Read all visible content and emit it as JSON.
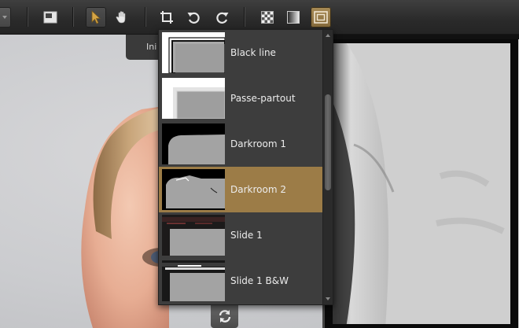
{
  "toolbar": {
    "tools": [
      {
        "icon": "layout-icon"
      },
      {
        "icon": "pointer-arrow-icon",
        "active": true
      },
      {
        "icon": "hand-pan-icon"
      },
      {
        "icon": "crop-icon"
      },
      {
        "icon": "rotate-left-icon"
      },
      {
        "icon": "rotate-right-icon"
      },
      {
        "icon": "checkerboard-icon"
      },
      {
        "icon": "gradient-square-icon"
      },
      {
        "icon": "frame-icon",
        "active": true
      }
    ]
  },
  "tab_hint": "Ini",
  "frame_menu": {
    "items": [
      {
        "label": "Black line",
        "thumb": "black-line"
      },
      {
        "label": "Passe-partout",
        "thumb": "passe-partout"
      },
      {
        "label": "Darkroom 1",
        "thumb": "darkroom-1"
      },
      {
        "label": "Darkroom 2",
        "thumb": "darkroom-2",
        "selected": true
      },
      {
        "label": "Slide 1",
        "thumb": "slide-1"
      },
      {
        "label": "Slide 1 B&W",
        "thumb": "slide-1-bw"
      }
    ],
    "scroll_position": 0.35
  },
  "colors": {
    "selected_bg": "#9c7c47",
    "menu_bg": "#3d3d3d",
    "toolbar_bg": "#2c2c2c"
  }
}
